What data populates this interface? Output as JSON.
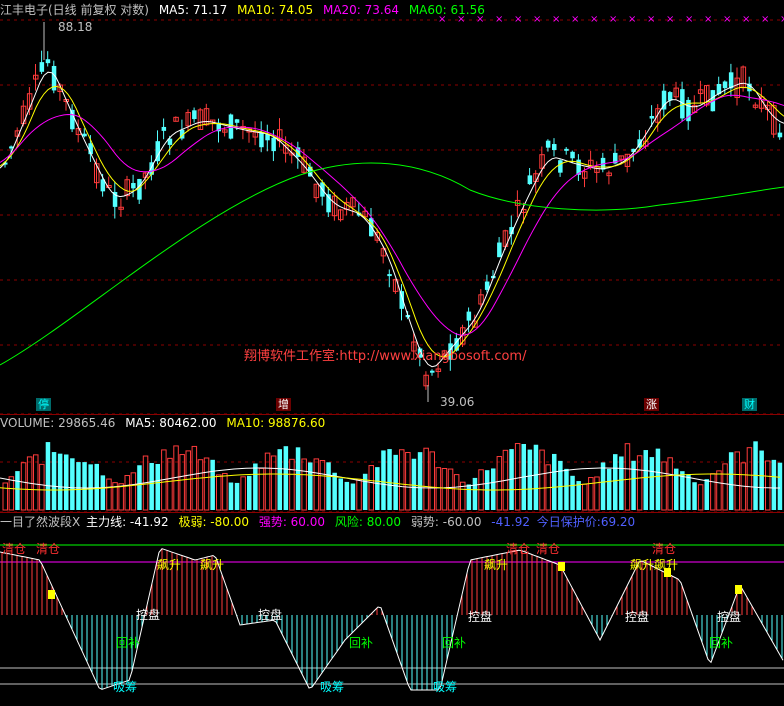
{
  "colors": {
    "up": "#ff3b3b",
    "down": "#54ffff",
    "ma5": "#ffffff",
    "ma10": "#ffff00",
    "ma20": "#ff00ff",
    "ma60": "#00ff00",
    "grid": "#8b0000",
    "text": "#c0c0c0"
  },
  "price_panel": {
    "title": "江丰电子(日线 前复权 对数)",
    "ma5_label": "MA5: 71.17",
    "ma10_label": "MA10: 74.05",
    "ma20_label": "MA20: 73.64",
    "ma60_label": "MA60: 61.56",
    "high_label": "88.18",
    "low_label": "39.06",
    "watermark": "翔博软件工作室:http://www.xiangbosoft.com/",
    "event_markers": [
      "停",
      "增",
      "涨",
      "财"
    ]
  },
  "volume_panel": {
    "volume_label": "VOLUME: 29865.46",
    "ma5_label": "MA5: 80462.00",
    "ma10_label": "MA10: 98876.60"
  },
  "indicator_panel": {
    "name": "一目了然波段X",
    "main_label": "主力线: -41.92",
    "extreme_weak": "极弱: -80.00",
    "strong": "强势: 60.00",
    "risk": "风险: 80.00",
    "weak": "弱势: -60.00",
    "value": "-41.92",
    "support": "今日保护价:69.20",
    "sell_label": "清仓",
    "surge_label": "飙升",
    "control_label": "控盘",
    "pullback_label": "回补",
    "absorb_label": "吸筹"
  }
}
